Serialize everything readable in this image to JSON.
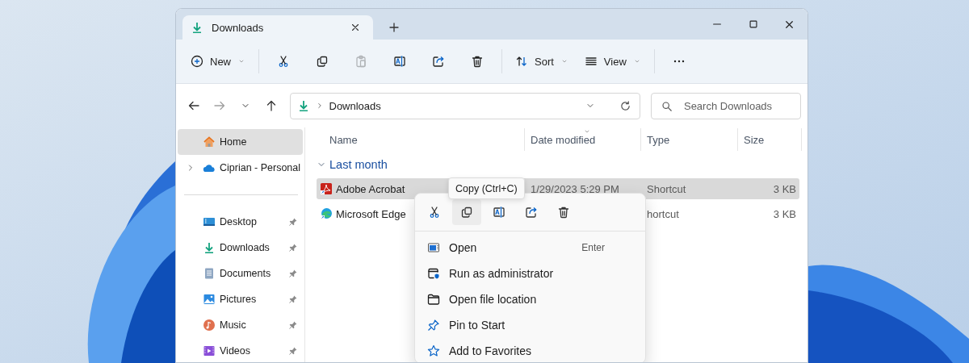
{
  "tabs": [
    {
      "label": "Downloads",
      "selected": true
    }
  ],
  "toolbar": {
    "groups": [
      {
        "buttons": [
          {
            "kind": "new",
            "label": "New",
            "dropdown": true,
            "disabled": false
          }
        ]
      },
      {
        "buttons": [
          {
            "kind": "cut",
            "dropdown": false,
            "disabled": false
          },
          {
            "kind": "copy",
            "dropdown": false,
            "disabled": false
          },
          {
            "kind": "paste",
            "dropdown": false,
            "disabled": true
          },
          {
            "kind": "rename",
            "dropdown": false,
            "disabled": false
          },
          {
            "kind": "share",
            "dropdown": false,
            "disabled": false
          },
          {
            "kind": "delete",
            "dropdown": false,
            "disabled": false
          }
        ]
      },
      {
        "buttons": [
          {
            "kind": "sort",
            "label": "Sort",
            "dropdown": true,
            "disabled": false
          },
          {
            "kind": "view",
            "label": "View",
            "dropdown": true,
            "disabled": false
          }
        ]
      },
      {
        "buttons": [
          {
            "kind": "more",
            "dropdown": false,
            "disabled": false
          }
        ]
      }
    ]
  },
  "navigation": [
    {
      "kind": "back",
      "disabled": false
    },
    {
      "kind": "forward",
      "disabled": true
    },
    {
      "kind": "recent",
      "disabled": false
    },
    {
      "kind": "up",
      "disabled": false
    }
  ],
  "address_bar": {
    "location": "Downloads"
  },
  "search": {
    "placeholder": "Search Downloads"
  },
  "sidebar": {
    "sections": [
      {
        "items": [
          {
            "label": "Home",
            "kind": "home",
            "selected": true,
            "expandable": false,
            "pinned": false
          },
          {
            "label": "Ciprian - Personal",
            "kind": "cloud",
            "selected": false,
            "expandable": true,
            "pinned": false
          }
        ]
      },
      {
        "items": [
          {
            "label": "Desktop",
            "kind": "desktop",
            "selected": false,
            "expandable": false,
            "pinned": true
          },
          {
            "label": "Downloads",
            "kind": "download",
            "selected": false,
            "expandable": false,
            "pinned": true
          },
          {
            "label": "Documents",
            "kind": "documents",
            "selected": false,
            "expandable": false,
            "pinned": true
          },
          {
            "label": "Pictures",
            "kind": "pictures",
            "selected": false,
            "expandable": false,
            "pinned": true
          },
          {
            "label": "Music",
            "kind": "music",
            "selected": false,
            "expandable": false,
            "pinned": true
          },
          {
            "label": "Videos",
            "kind": "videos",
            "selected": false,
            "expandable": false,
            "pinned": true
          }
        ]
      }
    ]
  },
  "file_list": {
    "columns": [
      {
        "label": "Name",
        "sorted": false
      },
      {
        "label": "Date modified",
        "sorted": true
      },
      {
        "label": "Type",
        "sorted": false
      },
      {
        "label": "Size",
        "sorted": false
      }
    ],
    "groups": [
      {
        "label": "Last month",
        "expanded": true,
        "rows": [
          {
            "name": "Adobe Acrobat",
            "kind": "acrobat",
            "date": "1/29/2023 5:29 PM",
            "type": "Shortcut",
            "size": "3 KB",
            "selected": true
          },
          {
            "name": "Microsoft Edge",
            "kind": "edge",
            "type": "hortcut",
            "size": "3 KB",
            "selected": false
          }
        ]
      }
    ]
  },
  "context_menu": {
    "quick_actions": [
      {
        "kind": "cut",
        "hovered": false
      },
      {
        "kind": "copy",
        "hovered": true
      },
      {
        "kind": "rename",
        "hovered": false
      },
      {
        "kind": "share",
        "hovered": false
      },
      {
        "kind": "delete",
        "hovered": false
      }
    ],
    "tooltip": "Copy (Ctrl+C)",
    "items": [
      {
        "label": "Open",
        "kind": "open",
        "shortcut": "Enter"
      },
      {
        "label": "Run as administrator",
        "kind": "admin"
      },
      {
        "label": "Open file location",
        "kind": "folder"
      },
      {
        "label": "Pin to Start",
        "kind": "pin"
      },
      {
        "label": "Add to Favorites",
        "kind": "star"
      }
    ]
  }
}
